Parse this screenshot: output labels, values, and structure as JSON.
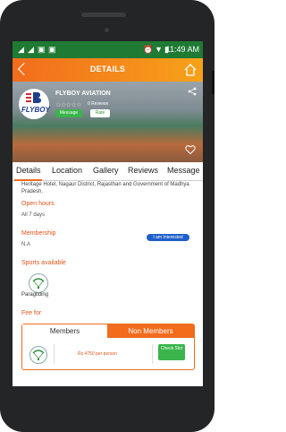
{
  "status_bar": {
    "time": "11:49 AM",
    "icons": [
      "signal-icon",
      "alarm-icon",
      "wifi-icon",
      "battery-icon"
    ]
  },
  "app_bar": {
    "title": "DETAILS"
  },
  "hero": {
    "logo_text": "FLYBOY",
    "name": "FLYBOY AVIATION",
    "stars": "☆☆☆☆☆",
    "reviews_count": "0 Reviews",
    "message_label": "Message",
    "rate_label": "Rate"
  },
  "tabs": [
    {
      "label": "Details"
    },
    {
      "label": "Location"
    },
    {
      "label": "Gallery"
    },
    {
      "label": "Reviews"
    },
    {
      "label": "Message"
    }
  ],
  "description": "Heritage Hotel, Nagaur District, Rajasthan and Government of Madhya Pradesh.",
  "open_hours": {
    "title": "Open hours",
    "value": "All 7 days"
  },
  "membership": {
    "title": "Membership",
    "value": "N.A",
    "button_label": "I am Interested"
  },
  "sports": {
    "title": "Sports available",
    "items": [
      {
        "label": "Paragliding"
      }
    ]
  },
  "fee": {
    "title": "Fee for",
    "tab_members": "Members",
    "tab_non_members": "Non Members",
    "price": "Rs 4750 per person",
    "check_slot_label": "Check Slot"
  },
  "colors": {
    "accent": "#f26c1c",
    "status_bar": "#1f7a33",
    "green_button": "#3ab54a",
    "blue_button": "#1f5fc9"
  }
}
